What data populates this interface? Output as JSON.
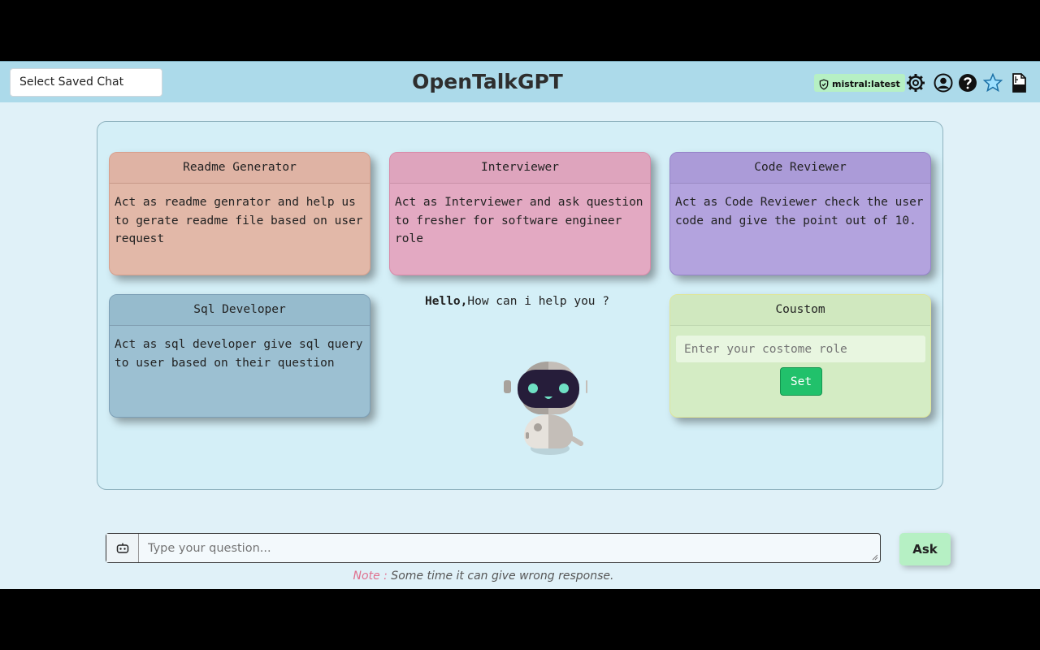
{
  "header": {
    "saved_chat_label": "Select Saved Chat",
    "title": "OpenTalkGPT",
    "model_badge": "mistral:latest",
    "icons": [
      "settings-gear-icon",
      "user-profile-icon",
      "help-icon",
      "star-icon",
      "rag-document-icon"
    ]
  },
  "roles": {
    "readme": {
      "title": "Readme Generator",
      "description": "Act as readme genrator and help us to gerate readme file based on user request"
    },
    "interviewer": {
      "title": "Interviewer",
      "description": "Act as Interviewer and ask question to fresher for software engineer role"
    },
    "code_reviewer": {
      "title": "Code Reviewer",
      "description": "Act as Code Reviewer check the user code and give the point out of 10."
    },
    "sql": {
      "title": "Sql Developer",
      "description": "Act as sql developer give sql query to user based on their question"
    },
    "custom": {
      "title": "Coustom",
      "placeholder": "Enter your costome role",
      "button": "Set"
    }
  },
  "greeting": {
    "bold": "Hello,",
    "text": "How can i help you ?"
  },
  "question_box": {
    "placeholder": "Type your question...",
    "ask_button": "Ask"
  },
  "note": {
    "label": "Note :",
    "text": " Some time it can give wrong response."
  },
  "colors": {
    "header_bg": "#acdaea",
    "accent_green": "#21c16b",
    "badge_bg": "#b6f0c4"
  }
}
